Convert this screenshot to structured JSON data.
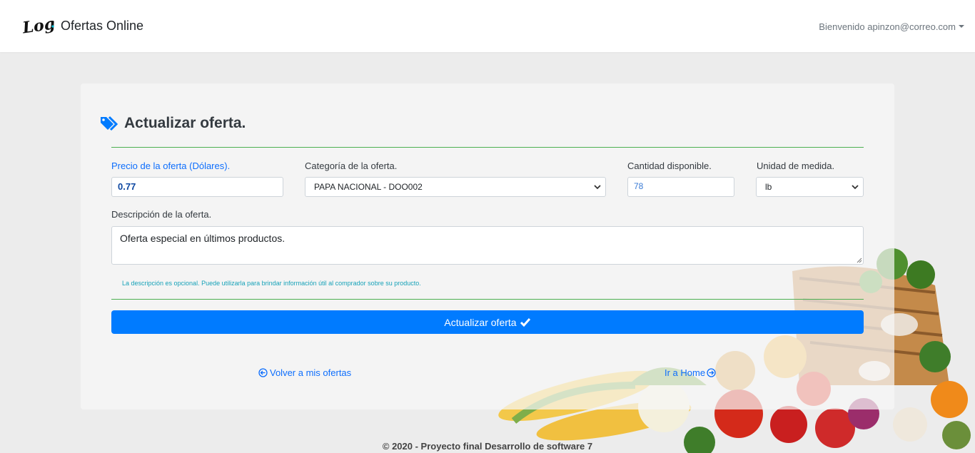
{
  "header": {
    "logo_text": "Logo",
    "brand": "Ofertas Online",
    "user_greeting": "Bienvenido apinzon@correo.com"
  },
  "form": {
    "title": "Actualizar oferta.",
    "price": {
      "label": "Precio de la oferta (Dólares).",
      "value": "0.77"
    },
    "category": {
      "label": "Categoría de la oferta.",
      "value": "PAPA NACIONAL - DOO002"
    },
    "quantity": {
      "label": "Cantidad disponible.",
      "value": "78"
    },
    "unit": {
      "label": "Unidad de medida.",
      "value": "lb"
    },
    "description": {
      "label": "Descripción de la oferta.",
      "value": "Oferta especial en últimos productos.",
      "helper": "La descripción es opcional. Puede utilizarla para brindar información útil al comprador sobre su producto."
    },
    "submit_label": "Actualizar oferta",
    "back_link": "Volver a mis ofertas",
    "home_link": "Ir a Home"
  },
  "footer": {
    "text": "© 2020 - Proyecto final Desarrollo de software 7"
  },
  "colors": {
    "accent": "#007bff",
    "divider": "#4caf50",
    "helper": "#17a2b8"
  }
}
